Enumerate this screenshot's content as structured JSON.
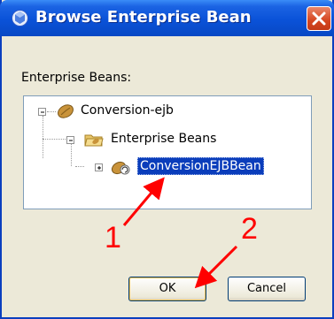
{
  "window": {
    "title": "Browse Enterprise Bean",
    "close_icon": "close-icon",
    "title_icon": "bean-icon"
  },
  "content": {
    "label": "Enterprise Beans:"
  },
  "tree": {
    "root": {
      "label": "Conversion-ejb",
      "icon": "ejb-module-icon",
      "expanded": true
    },
    "folder": {
      "label": "Enterprise Beans",
      "icon": "folder-icon",
      "expanded": true
    },
    "bean": {
      "label": "ConversionEJBBean",
      "icon": "session-bean-icon",
      "expanded": false,
      "selected": true
    }
  },
  "buttons": {
    "ok": "OK",
    "cancel": "Cancel"
  },
  "annotations": {
    "step1": "1",
    "step2": "2",
    "color": "#ff0000"
  },
  "colors": {
    "titlebar": "#0a52d8",
    "selection": "#0a3dbb",
    "dialog_bg": "#ece9d8"
  }
}
